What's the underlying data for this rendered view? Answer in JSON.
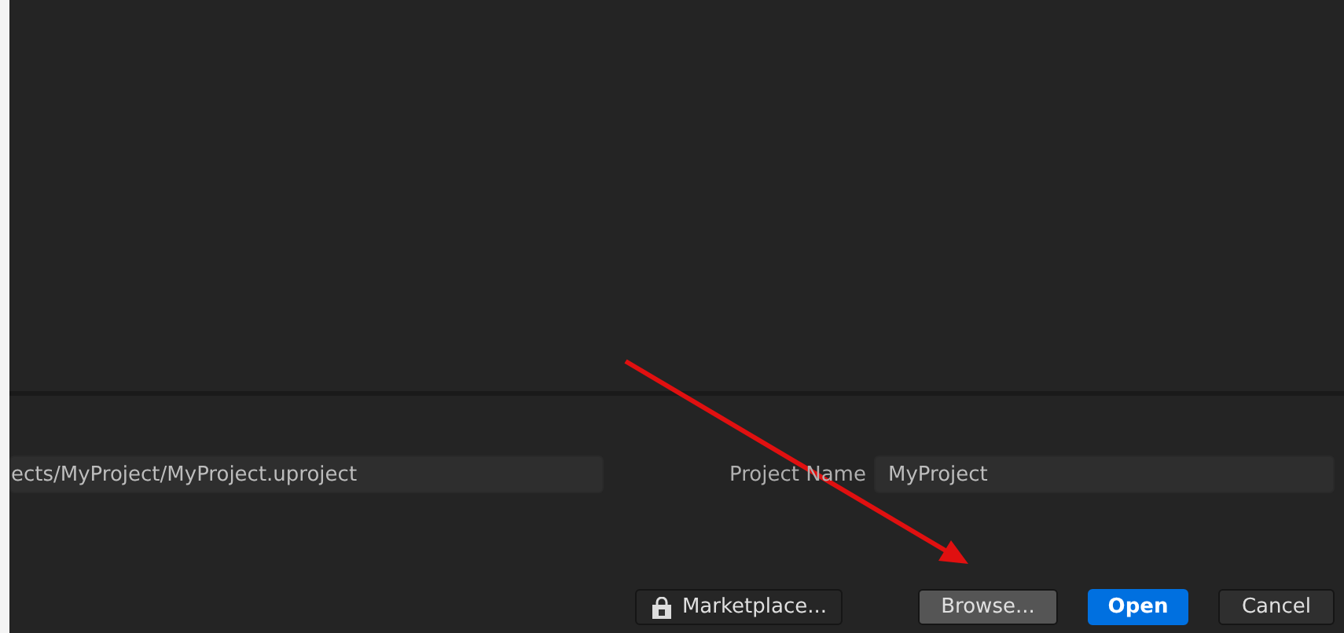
{
  "path_field": {
    "value": "ects/MyProject/MyProject.uproject"
  },
  "project_name": {
    "label": "Project Name",
    "value": "MyProject"
  },
  "buttons": [
    {
      "label": "Marketplace...",
      "kind": "store"
    },
    {
      "label": "Browse...",
      "kind": "secondary"
    },
    {
      "label": "Open",
      "kind": "primary"
    },
    {
      "label": "Cancel",
      "kind": "plain"
    }
  ]
}
